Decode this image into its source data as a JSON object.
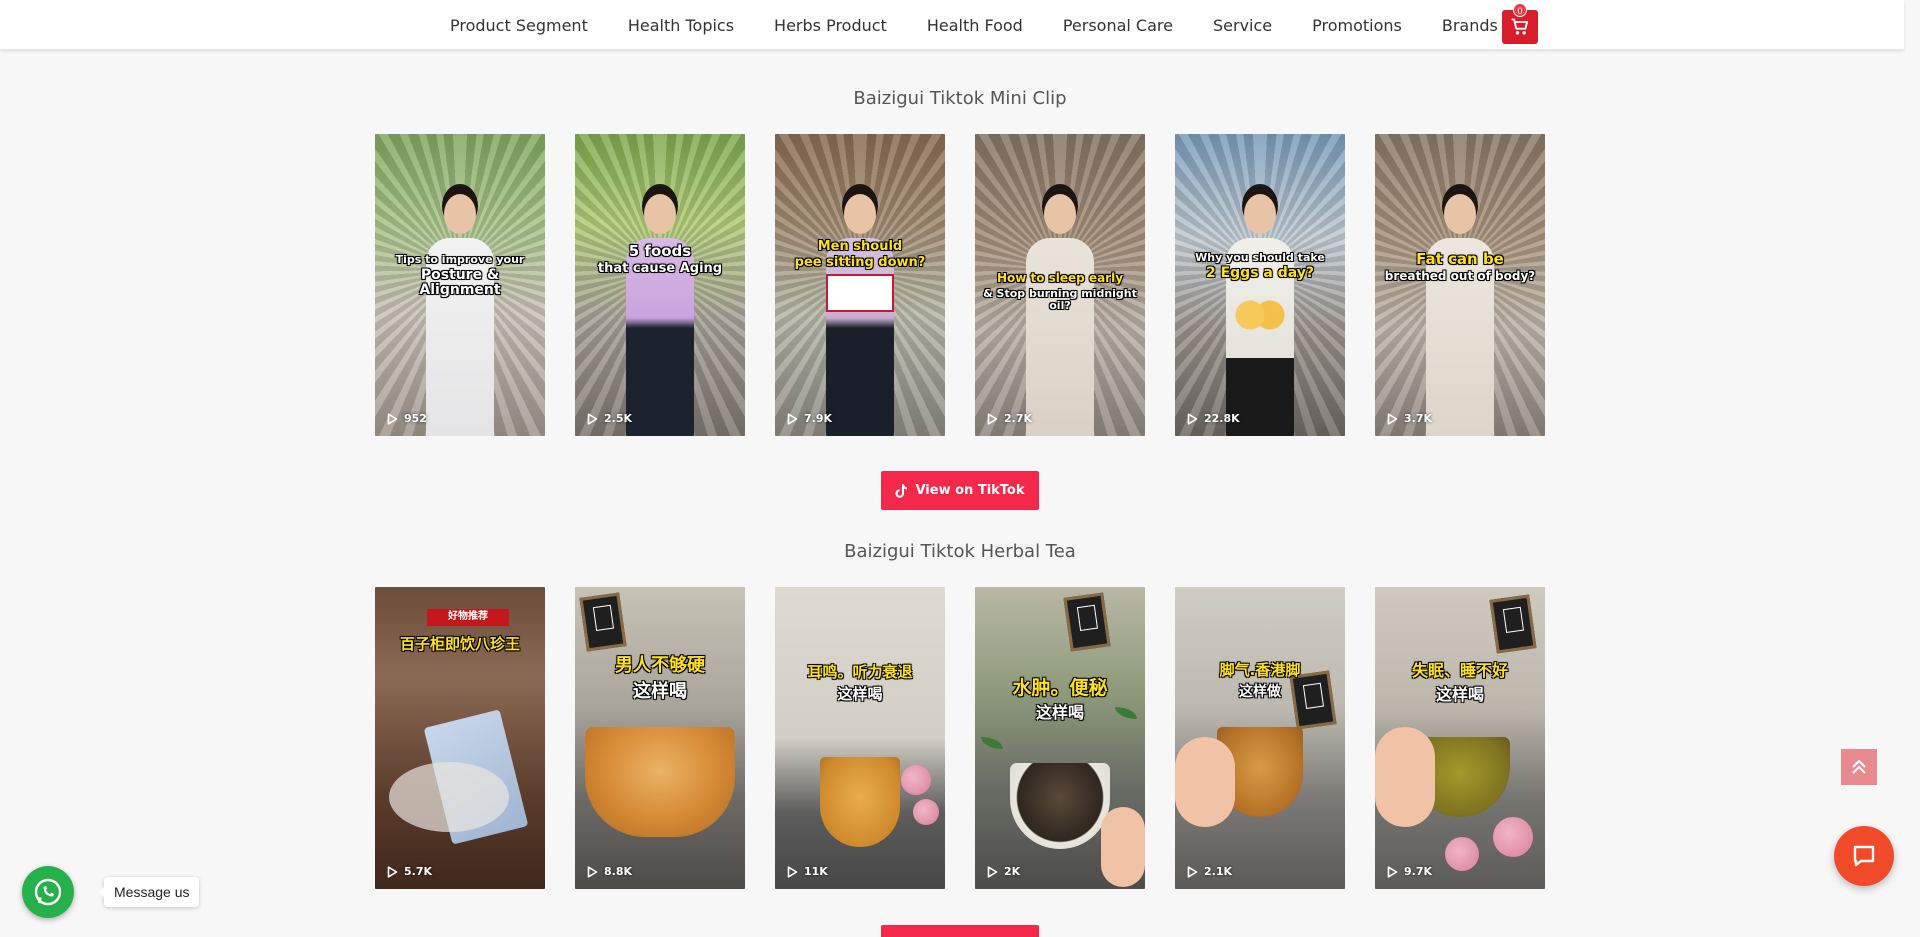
{
  "nav": {
    "items": [
      "Product Segment",
      "Health Topics",
      "Herbs Product",
      "Health Food",
      "Personal Care",
      "Service",
      "Promotions",
      "Brands"
    ],
    "cart_count": "0"
  },
  "mini_clip": {
    "title": "Baizigui Tiktok Mini Clip",
    "videos": [
      {
        "caption_top": "Tips to improve your",
        "caption_main": "Posture & Alignment",
        "views": "952"
      },
      {
        "caption_top": "5 foods",
        "caption_main": "that cause Aging",
        "views": "2.5K"
      },
      {
        "caption_top": "Men should",
        "caption_main": "pee sitting down?",
        "views": "7.9K"
      },
      {
        "caption_top": "How to sleep early",
        "caption_main": "& Stop burning midnight oil?",
        "views": "2.7K"
      },
      {
        "caption_top": "Why you should take",
        "caption_main": "2 Eggs a day?",
        "views": "22.8K"
      },
      {
        "caption_top": "Fat can be",
        "caption_main": "breathed out of body?",
        "views": "3.7K"
      }
    ],
    "button_label": "View on TikTok"
  },
  "herbal_tea": {
    "title": "Baizigui Tiktok Herbal Tea",
    "videos": [
      {
        "caption_top": "好物推荐",
        "caption_main": "百子柜即饮八珍王",
        "views": "5.7K"
      },
      {
        "caption_top": "男人不够硬",
        "caption_main": "这样喝",
        "views": "8.8K"
      },
      {
        "caption_top": "耳鸣。听力衰退",
        "caption_main": "这样喝",
        "views": "11K"
      },
      {
        "caption_top": "水肿。便秘",
        "caption_main": "这样喝",
        "views": "2K"
      },
      {
        "caption_top": "脚气.香港脚",
        "caption_main": "这样做",
        "views": "2.1K"
      },
      {
        "caption_top": "失眠、睡不好",
        "caption_main": "这样喝",
        "views": "9.7K"
      }
    ]
  },
  "widgets": {
    "whatsapp_label": "Message us"
  },
  "colors": {
    "accent_red": "#f3284a",
    "cart_red": "#d71e2a",
    "whatsapp_green": "#25b04b",
    "chat_orange": "#f04a28"
  }
}
